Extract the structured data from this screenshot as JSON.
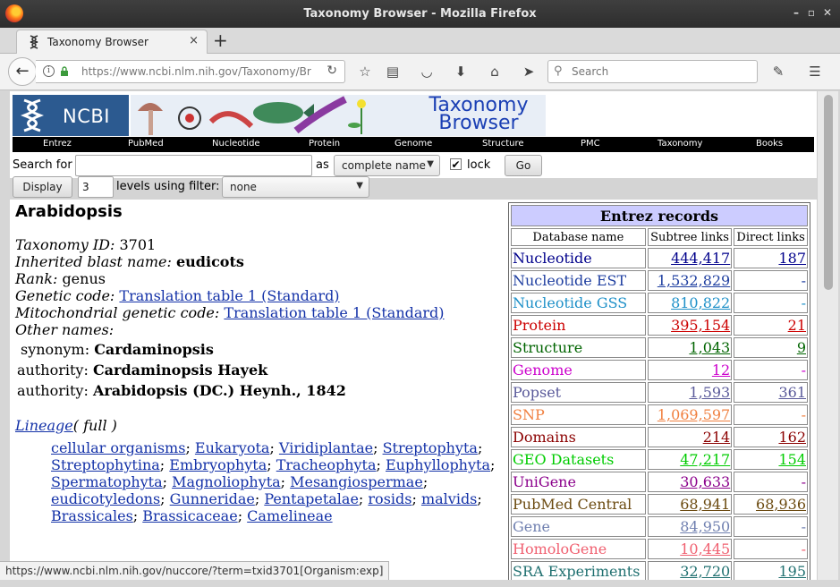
{
  "window": {
    "title": "Taxonomy Browser - Mozilla Firefox"
  },
  "tab": {
    "label": "Taxonomy Browser",
    "close": "×",
    "new_tab": "+"
  },
  "nav": {
    "url": "https://www.ncbi.nlm.nih.gov/Taxonomy/Br",
    "search_placeholder": "Search"
  },
  "banner": {
    "logo_text": "NCBI",
    "title_line1": "Taxonomy",
    "title_line2": "Browser"
  },
  "menu": [
    "Entrez",
    "PubMed",
    "Nucleotide",
    "Protein",
    "Genome",
    "Structure",
    "PMC",
    "Taxonomy",
    "Books"
  ],
  "search_form": {
    "search_for_label": "Search for",
    "search_value": "",
    "as_label": "as",
    "mode_value": "complete name",
    "lock_label": "lock",
    "lock_checked": true,
    "go_label": "Go",
    "display_label": "Display",
    "levels_value": "3",
    "levels_label": "levels using filter:",
    "filter_value": "none"
  },
  "taxon": {
    "name": "Arabidopsis",
    "taxonomy_id_label": "Taxonomy ID:",
    "taxonomy_id": "3701",
    "blast_label": "Inherited blast name:",
    "blast_name": "eudicots",
    "rank_label": "Rank:",
    "rank": "genus",
    "genetic_code_label": "Genetic code:",
    "genetic_code": "Translation table 1 (Standard)",
    "mito_code_label": "Mitochondrial genetic code:",
    "mito_code": "Translation table 1 (Standard)",
    "other_names_label": "Other names:",
    "other_names": [
      {
        "type": "synonym:",
        "value": "Cardaminopsis"
      },
      {
        "type": "authority:",
        "value": "Cardaminopsis Hayek"
      },
      {
        "type": "authority:",
        "value": "Arabidopsis (DC.) Heynh., 1842"
      }
    ],
    "lineage_label": "Lineage",
    "lineage_full": "( full )",
    "lineage": [
      "cellular organisms",
      "Eukaryota",
      "Viridiplantae",
      "Streptophyta",
      "Streptophytina",
      "Embryophyta",
      "Tracheophyta",
      "Euphyllophyta",
      "Spermatophyta",
      "Magnoliophyta",
      "Mesangiospermae",
      "eudicotyledons",
      "Gunneridae",
      "Pentapetalae",
      "rosids",
      "malvids",
      "Brassicales",
      "Brassicaceae",
      "Camelineae"
    ]
  },
  "entrez": {
    "title": "Entrez records",
    "col_db": "Database name",
    "col_subtree": "Subtree links",
    "col_direct": "Direct links",
    "rows": [
      {
        "db": "Nucleotide",
        "subtree": "444,417",
        "direct": "187",
        "color": "#00008b"
      },
      {
        "db": "Nucleotide EST",
        "subtree": "1,532,829",
        "direct": "-",
        "color": "#1f3fa0"
      },
      {
        "db": "Nucleotide GSS",
        "subtree": "810,822",
        "direct": "-",
        "color": "#1e90c8"
      },
      {
        "db": "Protein",
        "subtree": "395,154",
        "direct": "21",
        "color": "#cc0000"
      },
      {
        "db": "Structure",
        "subtree": "1,043",
        "direct": "9",
        "color": "#006400"
      },
      {
        "db": "Genome",
        "subtree": "12",
        "direct": "-",
        "color": "#cc00cc"
      },
      {
        "db": "Popset",
        "subtree": "1,593",
        "direct": "361",
        "color": "#5a5a9a"
      },
      {
        "db": "SNP",
        "subtree": "1,069,597",
        "direct": "-",
        "color": "#f08040"
      },
      {
        "db": "Domains",
        "subtree": "214",
        "direct": "162",
        "color": "#8b0000"
      },
      {
        "db": "GEO Datasets",
        "subtree": "47,217",
        "direct": "154",
        "color": "#00cc00"
      },
      {
        "db": "UniGene",
        "subtree": "30,633",
        "direct": "-",
        "color": "#8b008b"
      },
      {
        "db": "PubMed Central",
        "subtree": "68,941",
        "direct": "68,936",
        "color": "#6b4a10"
      },
      {
        "db": "Gene",
        "subtree": "84,950",
        "direct": "-",
        "color": "#7080b0"
      },
      {
        "db": "HomoloGene",
        "subtree": "10,445",
        "direct": "-",
        "color": "#f06070"
      },
      {
        "db": "SRA Experiments",
        "subtree": "32,720",
        "direct": "195",
        "color": "#207070"
      }
    ]
  },
  "status_bar": {
    "text": "https://www.ncbi.nlm.nih.gov/nuccore/?term=txid3701[Organism:exp]"
  }
}
